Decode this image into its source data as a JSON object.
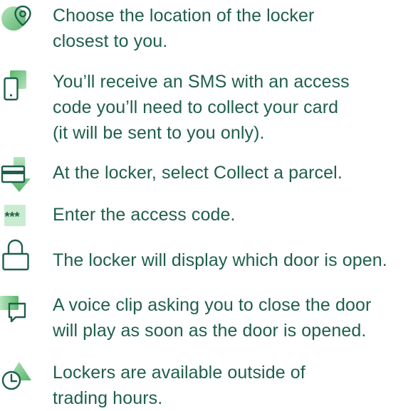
{
  "colors": {
    "text": "#1f5f4a",
    "icon_stroke": "#1f5f4a",
    "accent_light": "#7fd08f",
    "accent_mid": "#58b56b",
    "accent_soft": "#b6e4be"
  },
  "steps": [
    {
      "icon": "location-pin-icon",
      "lines": [
        "Choose the location of the locker",
        "closest to you."
      ]
    },
    {
      "icon": "mobile-phone-icon",
      "lines": [
        "You’ll receive an SMS with an access",
        "code you’ll need to collect your card",
        "(it will be sent to you only)."
      ]
    },
    {
      "icon": "card-icon",
      "lines": [
        "At the locker, select Collect a parcel."
      ]
    },
    {
      "icon": "password-icon",
      "icon_text": "***",
      "lines": [
        "Enter the access code."
      ]
    },
    {
      "icon": "padlock-icon",
      "lines": [
        "The locker will display which door is open."
      ]
    },
    {
      "icon": "speech-bubble-icon",
      "lines": [
        "A voice clip asking you to close the door",
        "will play as soon as the door is opened."
      ]
    },
    {
      "icon": "clock-icon",
      "lines": [
        "Lockers are available outside of",
        "trading hours."
      ]
    }
  ]
}
